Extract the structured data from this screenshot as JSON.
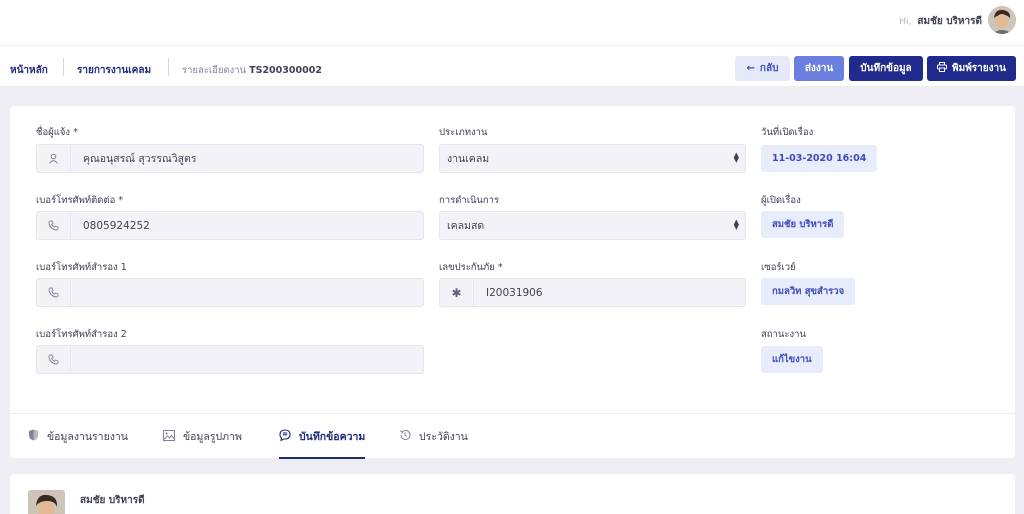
{
  "user": {
    "greeting": "Hi,",
    "name": "สมชัย บริหารดี"
  },
  "breadcrumb": {
    "home": "หน้าหลัก",
    "list": "รายการงานเคลม",
    "detail_prefix": "รายละเอียดงาน",
    "detail_id": "TS200300002"
  },
  "toolbar": {
    "back_label": "กลับ",
    "send_label": "ส่งงาน",
    "save_label": "บันทึกข้อมูล",
    "print_label": "พิมพ์รายงาน"
  },
  "form": {
    "reporter": {
      "label": "ชื่อผู้แจ้ง *",
      "value": "คุณอนุสรณ์ สุวรรณวิสูตร"
    },
    "contact_phone": {
      "label": "เบอร์โทรศัพท์ติดต่อ *",
      "value": "0805924252"
    },
    "backup_phone1": {
      "label": "เบอร์โทรศัพท์สำรอง 1",
      "value": ""
    },
    "backup_phone2": {
      "label": "เบอร์โทรศัพท์สำรอง 2",
      "value": ""
    },
    "job_type": {
      "label": "ประเภทงาน",
      "value": "งานเคลม"
    },
    "operation": {
      "label": "การดำเนินการ",
      "value": "เคลมสด"
    },
    "insurance_no": {
      "label": "เลขประกันภัย *",
      "value": "I20031906"
    },
    "open_date": {
      "label": "วันที่เปิดเรื่อง",
      "value": "11-03-2020 16:04"
    },
    "opener": {
      "label": "ผู้เปิดเรื่อง",
      "value": "สมชัย บริหารดี"
    },
    "surveyor": {
      "label": "เซอร์เวย์",
      "value": "กมลวิท สุขสำรวจ"
    },
    "status": {
      "label": "สถานะงาน",
      "value": "แก้ไขงาน"
    }
  },
  "tabs": [
    {
      "label": "ข้อมูลงานรายงาน",
      "icon": "shield-icon"
    },
    {
      "label": "ข้อมูลรูปภาพ",
      "icon": "image-icon"
    },
    {
      "label": "บันทึกข้อความ",
      "icon": "chat-icon",
      "active": true
    },
    {
      "label": "ประวัติงาน",
      "icon": "history-icon"
    }
  ],
  "message": {
    "author": "สมชัย บริหารดี"
  }
}
